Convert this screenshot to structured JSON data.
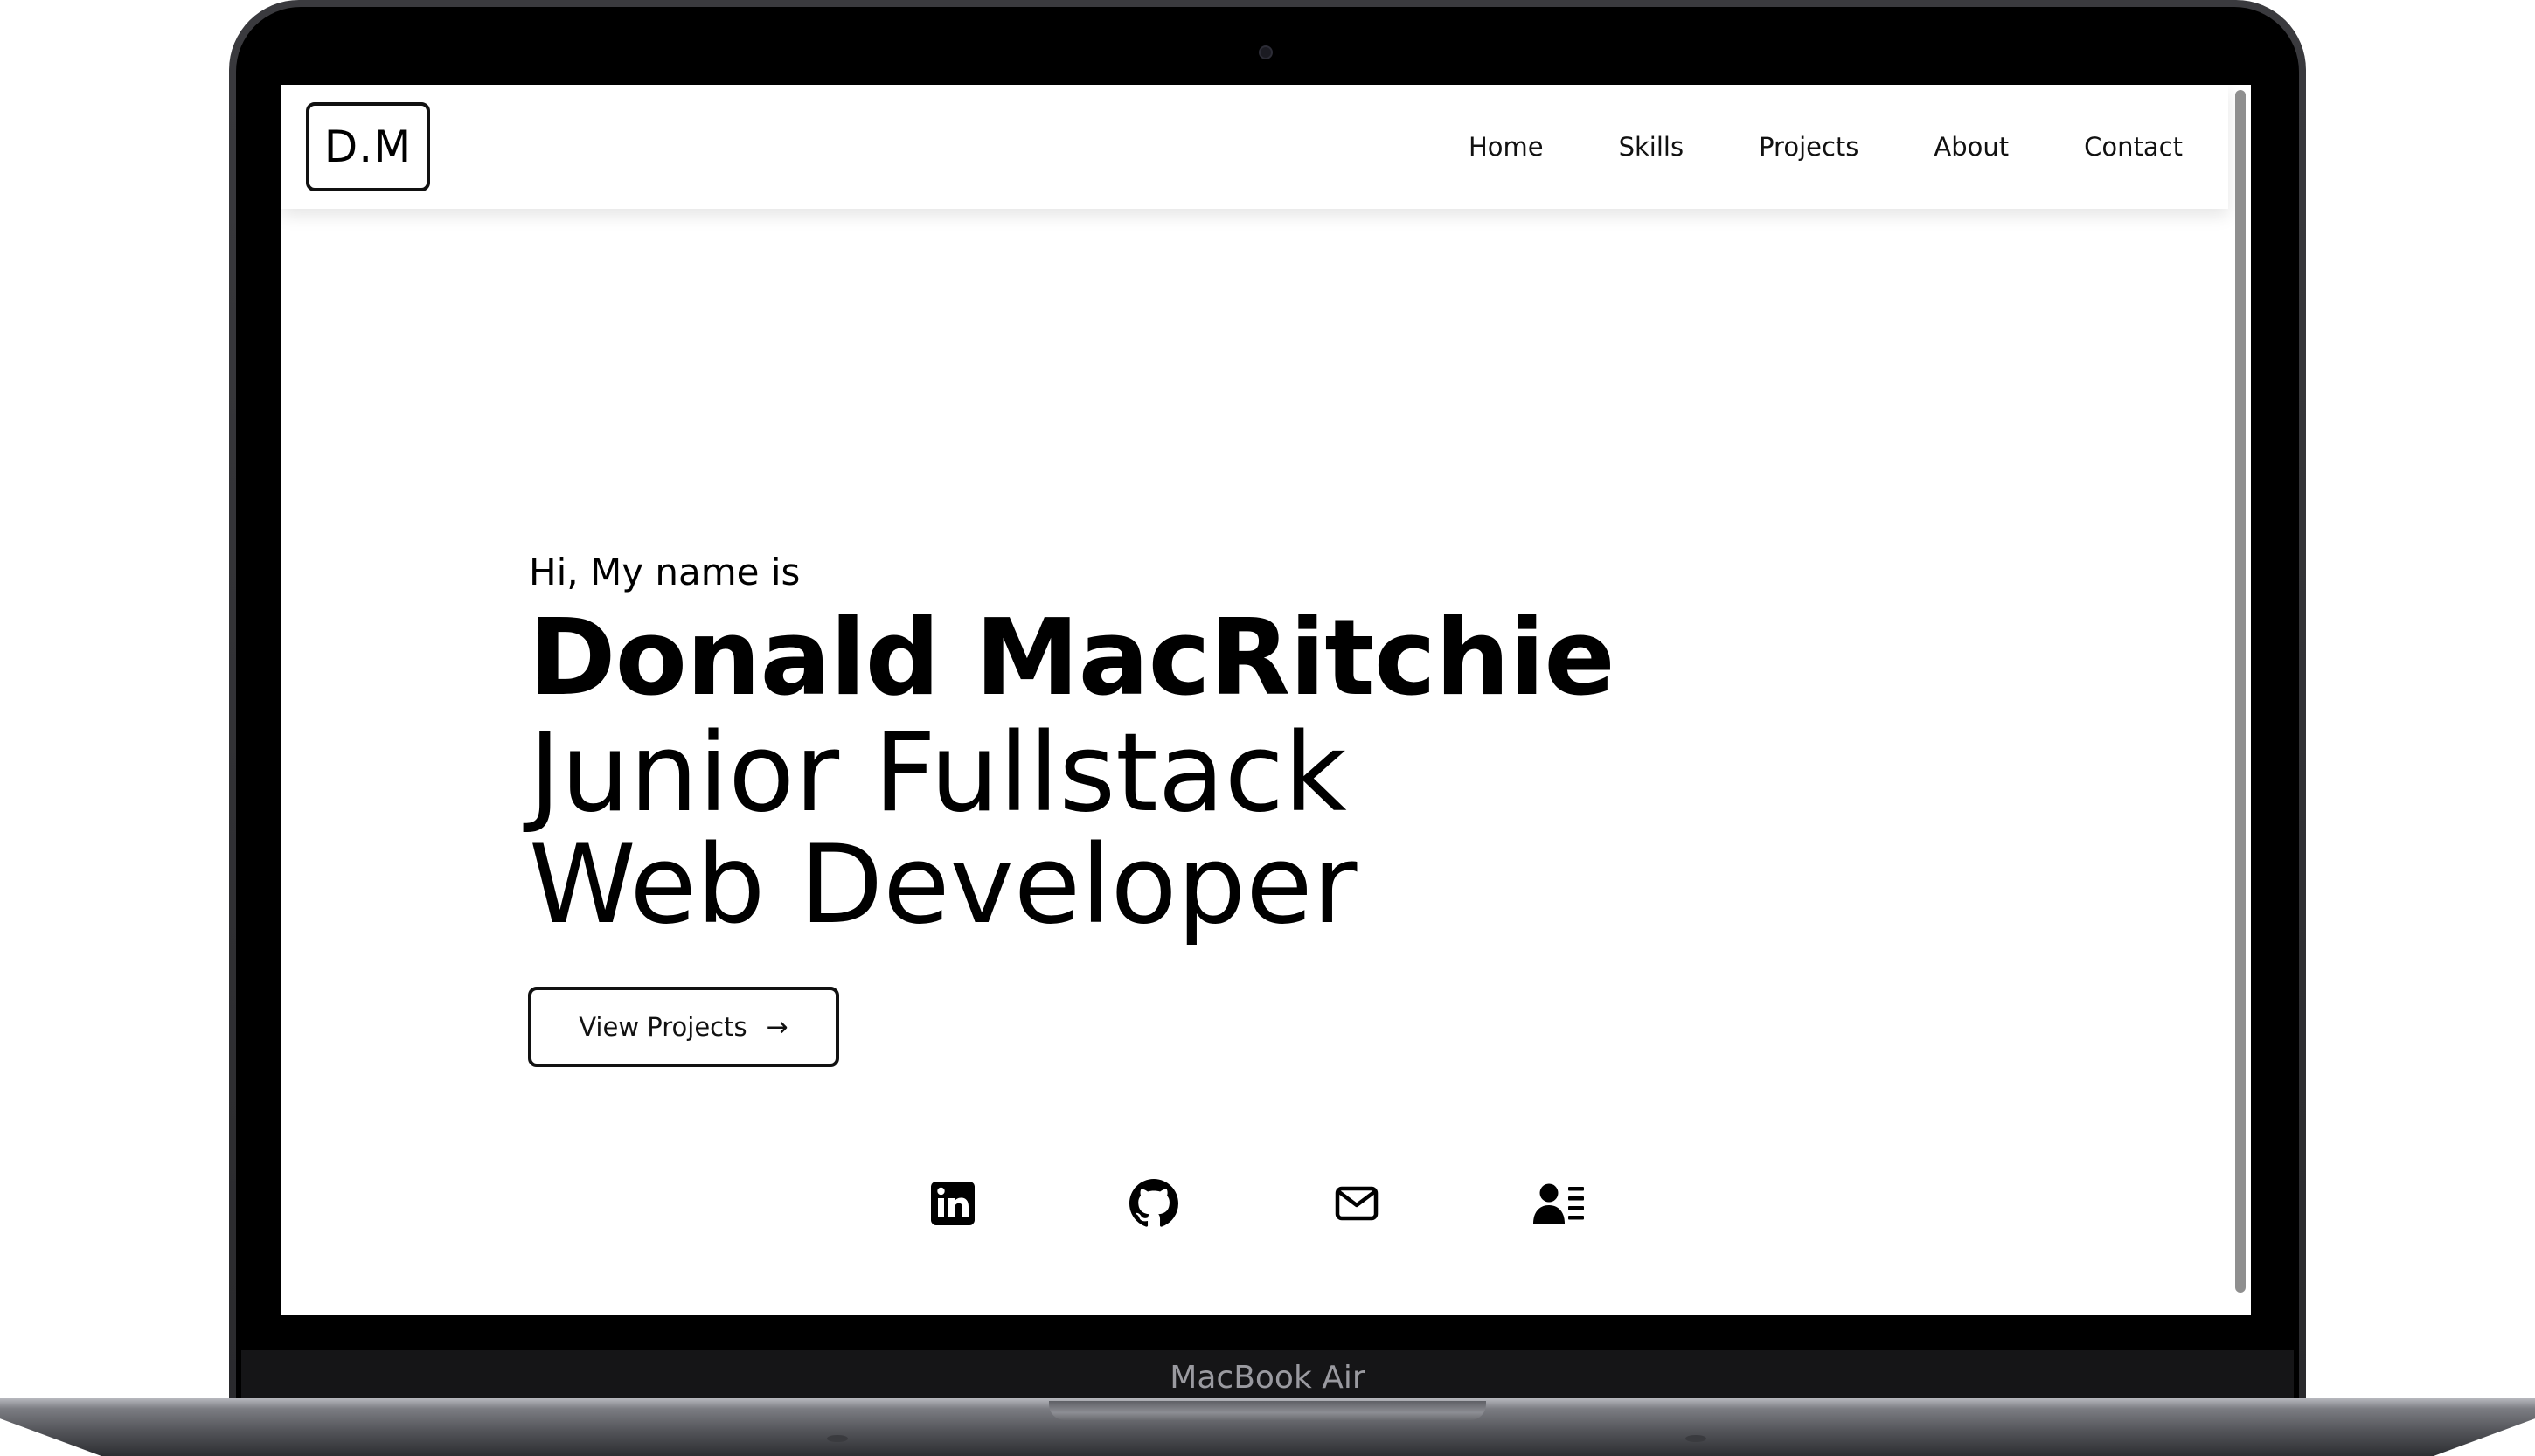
{
  "device": {
    "label": "MacBook Air"
  },
  "navbar": {
    "logo": "D.M",
    "links": [
      {
        "label": "Home"
      },
      {
        "label": "Skills"
      },
      {
        "label": "Projects"
      },
      {
        "label": "About"
      },
      {
        "label": "Contact"
      }
    ]
  },
  "hero": {
    "greeting": "Hi, My name is",
    "name": "Donald MacRitchie",
    "role_line1": "Junior Fullstack",
    "role_line2": "Web Developer",
    "cta": {
      "label": "View Projects",
      "arrow": "→"
    }
  },
  "social": [
    {
      "icon": "linkedin-icon"
    },
    {
      "icon": "github-icon"
    },
    {
      "icon": "mail-icon"
    },
    {
      "icon": "resume-icon"
    }
  ],
  "colors": {
    "text": "#000000",
    "page_background": "#ffffff",
    "bezel": "#000000"
  }
}
